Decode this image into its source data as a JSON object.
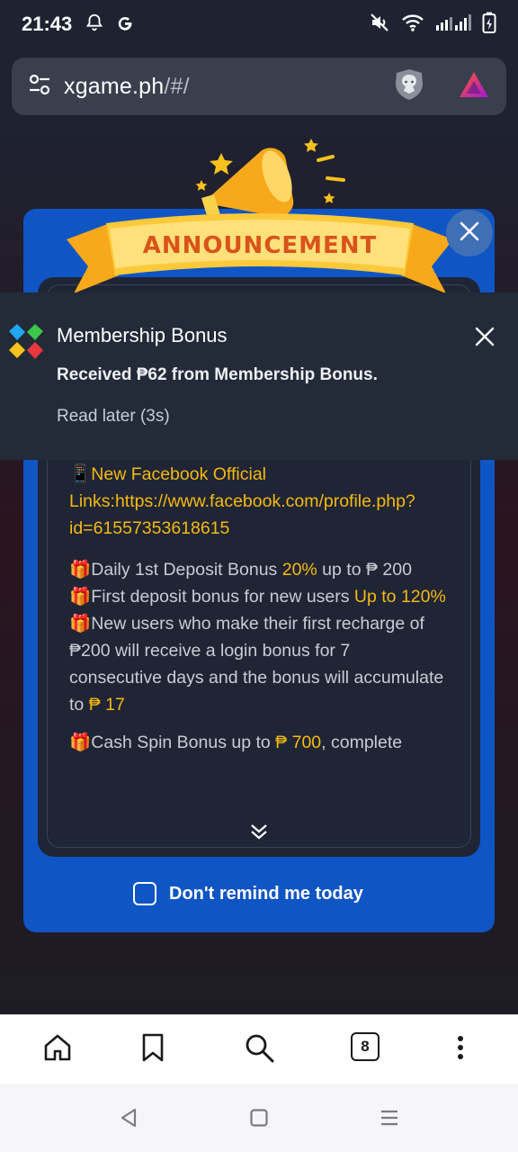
{
  "status_bar": {
    "time": "21:43",
    "left_icons": [
      "bell-icon",
      "google-icon"
    ],
    "right_icons": [
      "mute-icon",
      "wifi-icon",
      "signal-icon",
      "battery-icon"
    ]
  },
  "browser": {
    "url_domain": "xgame.ph",
    "url_path": "/#/",
    "icons": [
      "site-settings-icon",
      "brave-shields-icon",
      "brave-rewards-icon"
    ]
  },
  "modal": {
    "banner_text": "ANNOUNCEMENT",
    "content": {
      "facebook": {
        "prefix": "📱",
        "text": "New Facebook Official Links:https://www.facebook.com/profile.php?id=61557353618615"
      },
      "daily_bonus": {
        "prefix": "🎁",
        "text": "Daily 1st Deposit Bonus ",
        "highlight": "20%",
        "suffix": "  up to ₱ 200"
      },
      "first_deposit": {
        "prefix": "🎁",
        "text": "First deposit bonus for new users ",
        "highlight": "Up to 120%"
      },
      "login_bonus": {
        "prefix": "🎁",
        "text": "New users who make their first recharge of ₱200 will receive a login bonus for 7 consecutive days and the bonus will accumulate to ",
        "highlight": "₱ 17"
      },
      "cash_spin": {
        "prefix": "🎁",
        "text": "Cash Spin Bonus up to ",
        "highlight": "₱ 700",
        "suffix": ", complete"
      }
    },
    "dont_remind_label": "Don't remind me today"
  },
  "notification": {
    "title": "Membership Bonus",
    "body": "Received ₱62 from Membership Bonus.",
    "read_later": "Read later (3s)"
  },
  "bottom_nav": {
    "tab_count": "8",
    "items": [
      "home-icon",
      "bookmark-icon",
      "search-icon",
      "tabs-icon",
      "more-icon"
    ]
  },
  "colors": {
    "modal_blue": "#0f55c4",
    "highlight_yellow": "#f5b90f",
    "notification_bg": "#232a38"
  }
}
